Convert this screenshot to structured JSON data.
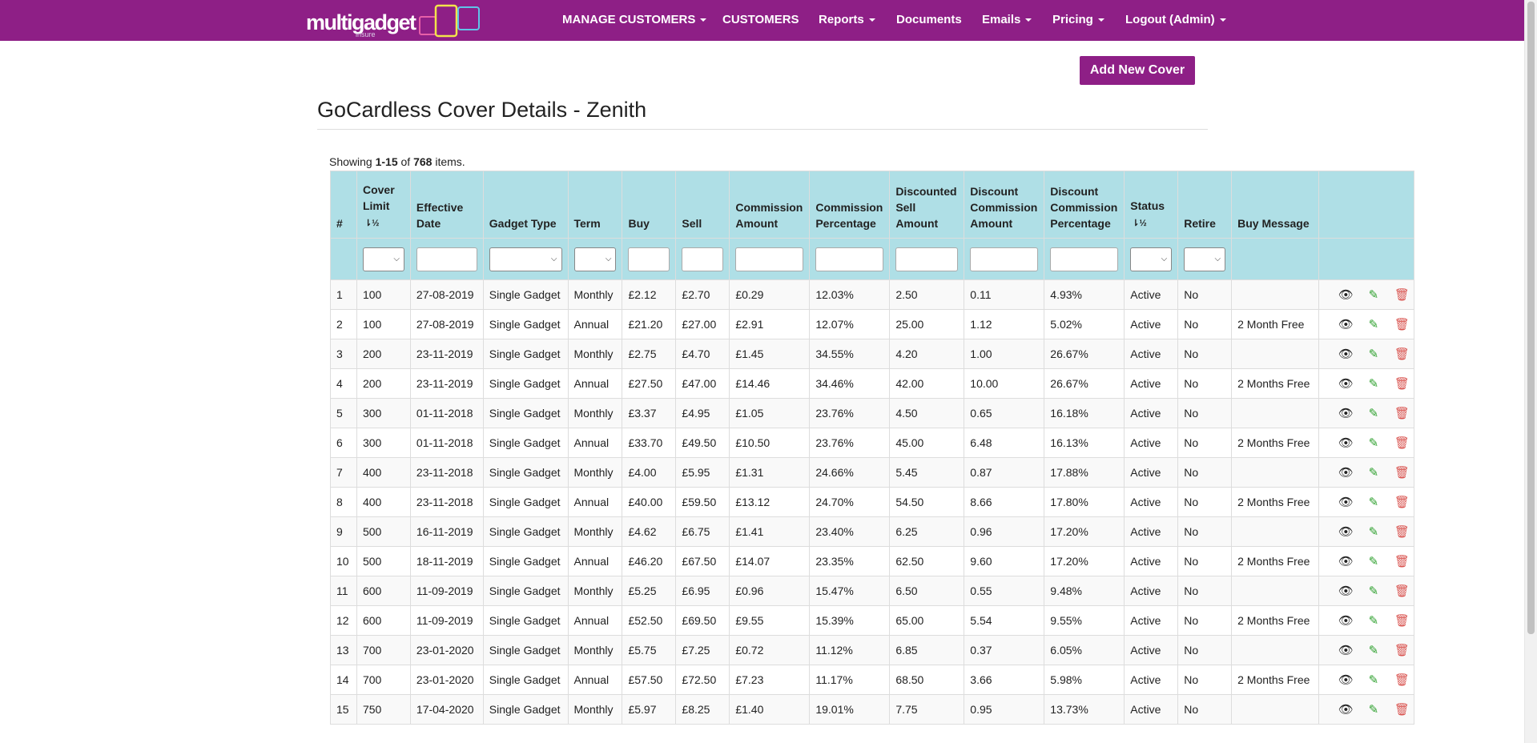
{
  "brand": {
    "logo_text": "multigadget",
    "logo_sub": "insure"
  },
  "nav": {
    "manage_customers": "MANAGE CUSTOMERS",
    "customers": "CUSTOMERS",
    "reports": "Reports",
    "documents": "Documents",
    "emails": "Emails",
    "pricing": "Pricing",
    "logout": "Logout (Admin)"
  },
  "toolbar": {
    "add_new_cover": "Add New Cover"
  },
  "page": {
    "title": "GoCardless Cover Details - Zenith"
  },
  "summary": {
    "prefix": "Showing ",
    "range": "1-15",
    "of": " of ",
    "total": "768",
    "suffix": " items."
  },
  "table": {
    "headers": {
      "num": "#",
      "cover_limit": "Cover Limit",
      "effective_date": "Effective Date",
      "gadget_type": "Gadget Type",
      "term": "Term",
      "buy": "Buy",
      "sell": "Sell",
      "commission_amount": "Commission Amount",
      "commission_percentage": "Commission Percentage",
      "discounted_sell_amount": "Discounted Sell Amount",
      "discount_commission_amount": "Discount Commission Amount",
      "discount_commission_percentage": "Discount Commission Percentage",
      "status": "Status",
      "retire": "Retire",
      "buy_message": "Buy Message"
    },
    "rows": [
      {
        "n": "1",
        "limit": "100",
        "date": "27-08-2019",
        "type": "Single Gadget",
        "term": "Monthly",
        "buy": "£2.12",
        "sell": "£2.70",
        "comm": "£0.29",
        "pct": "12.03%",
        "dsell": "2.50",
        "dcomm": "0.11",
        "dpct": "4.93%",
        "status": "Active",
        "retire": "No",
        "msg": ""
      },
      {
        "n": "2",
        "limit": "100",
        "date": "27-08-2019",
        "type": "Single Gadget",
        "term": "Annual",
        "buy": "£21.20",
        "sell": "£27.00",
        "comm": "£2.91",
        "pct": "12.07%",
        "dsell": "25.00",
        "dcomm": "1.12",
        "dpct": "5.02%",
        "status": "Active",
        "retire": "No",
        "msg": "2 Month Free"
      },
      {
        "n": "3",
        "limit": "200",
        "date": "23-11-2019",
        "type": "Single Gadget",
        "term": "Monthly",
        "buy": "£2.75",
        "sell": "£4.70",
        "comm": "£1.45",
        "pct": "34.55%",
        "dsell": "4.20",
        "dcomm": "1.00",
        "dpct": "26.67%",
        "status": "Active",
        "retire": "No",
        "msg": ""
      },
      {
        "n": "4",
        "limit": "200",
        "date": "23-11-2019",
        "type": "Single Gadget",
        "term": "Annual",
        "buy": "£27.50",
        "sell": "£47.00",
        "comm": "£14.46",
        "pct": "34.46%",
        "dsell": "42.00",
        "dcomm": "10.00",
        "dpct": "26.67%",
        "status": "Active",
        "retire": "No",
        "msg": "2 Months Free"
      },
      {
        "n": "5",
        "limit": "300",
        "date": "01-11-2018",
        "type": "Single Gadget",
        "term": "Monthly",
        "buy": "£3.37",
        "sell": "£4.95",
        "comm": "£1.05",
        "pct": "23.76%",
        "dsell": "4.50",
        "dcomm": "0.65",
        "dpct": "16.18%",
        "status": "Active",
        "retire": "No",
        "msg": ""
      },
      {
        "n": "6",
        "limit": "300",
        "date": "01-11-2018",
        "type": "Single Gadget",
        "term": "Annual",
        "buy": "£33.70",
        "sell": "£49.50",
        "comm": "£10.50",
        "pct": "23.76%",
        "dsell": "45.00",
        "dcomm": "6.48",
        "dpct": "16.13%",
        "status": "Active",
        "retire": "No",
        "msg": "2 Months Free"
      },
      {
        "n": "7",
        "limit": "400",
        "date": "23-11-2018",
        "type": "Single Gadget",
        "term": "Monthly",
        "buy": "£4.00",
        "sell": "£5.95",
        "comm": "£1.31",
        "pct": "24.66%",
        "dsell": "5.45",
        "dcomm": "0.87",
        "dpct": "17.88%",
        "status": "Active",
        "retire": "No",
        "msg": ""
      },
      {
        "n": "8",
        "limit": "400",
        "date": "23-11-2018",
        "type": "Single Gadget",
        "term": "Annual",
        "buy": "£40.00",
        "sell": "£59.50",
        "comm": "£13.12",
        "pct": "24.70%",
        "dsell": "54.50",
        "dcomm": "8.66",
        "dpct": "17.80%",
        "status": "Active",
        "retire": "No",
        "msg": "2 Months Free"
      },
      {
        "n": "9",
        "limit": "500",
        "date": "16-11-2019",
        "type": "Single Gadget",
        "term": "Monthly",
        "buy": "£4.62",
        "sell": "£6.75",
        "comm": "£1.41",
        "pct": "23.40%",
        "dsell": "6.25",
        "dcomm": "0.96",
        "dpct": "17.20%",
        "status": "Active",
        "retire": "No",
        "msg": ""
      },
      {
        "n": "10",
        "limit": "500",
        "date": "18-11-2019",
        "type": "Single Gadget",
        "term": "Annual",
        "buy": "£46.20",
        "sell": "£67.50",
        "comm": "£14.07",
        "pct": "23.35%",
        "dsell": "62.50",
        "dcomm": "9.60",
        "dpct": "17.20%",
        "status": "Active",
        "retire": "No",
        "msg": "2 Months Free"
      },
      {
        "n": "11",
        "limit": "600",
        "date": "11-09-2019",
        "type": "Single Gadget",
        "term": "Monthly",
        "buy": "£5.25",
        "sell": "£6.95",
        "comm": "£0.96",
        "pct": "15.47%",
        "dsell": "6.50",
        "dcomm": "0.55",
        "dpct": "9.48%",
        "status": "Active",
        "retire": "No",
        "msg": ""
      },
      {
        "n": "12",
        "limit": "600",
        "date": "11-09-2019",
        "type": "Single Gadget",
        "term": "Annual",
        "buy": "£52.50",
        "sell": "£69.50",
        "comm": "£9.55",
        "pct": "15.39%",
        "dsell": "65.00",
        "dcomm": "5.54",
        "dpct": "9.55%",
        "status": "Active",
        "retire": "No",
        "msg": "2 Months Free"
      },
      {
        "n": "13",
        "limit": "700",
        "date": "23-01-2020",
        "type": "Single Gadget",
        "term": "Monthly",
        "buy": "£5.75",
        "sell": "£7.25",
        "comm": "£0.72",
        "pct": "11.12%",
        "dsell": "6.85",
        "dcomm": "0.37",
        "dpct": "6.05%",
        "status": "Active",
        "retire": "No",
        "msg": ""
      },
      {
        "n": "14",
        "limit": "700",
        "date": "23-01-2020",
        "type": "Single Gadget",
        "term": "Annual",
        "buy": "£57.50",
        "sell": "£72.50",
        "comm": "£7.23",
        "pct": "11.17%",
        "dsell": "68.50",
        "dcomm": "3.66",
        "dpct": "5.98%",
        "status": "Active",
        "retire": "No",
        "msg": "2 Months Free"
      },
      {
        "n": "15",
        "limit": "750",
        "date": "17-04-2020",
        "type": "Single Gadget",
        "term": "Monthly",
        "buy": "£5.97",
        "sell": "£8.25",
        "comm": "£1.40",
        "pct": "19.01%",
        "dsell": "7.75",
        "dcomm": "0.95",
        "dpct": "13.73%",
        "status": "Active",
        "retire": "No",
        "msg": ""
      }
    ]
  },
  "icons": {
    "view": "eye-icon",
    "edit": "pencil-icon",
    "delete": "trash-icon",
    "sort": "sort-numeric-icon"
  },
  "colors": {
    "brand": "#8e1f86",
    "header_bg": "#afdfe6",
    "edit": "#2ea02e",
    "delete": "#d9534f"
  }
}
